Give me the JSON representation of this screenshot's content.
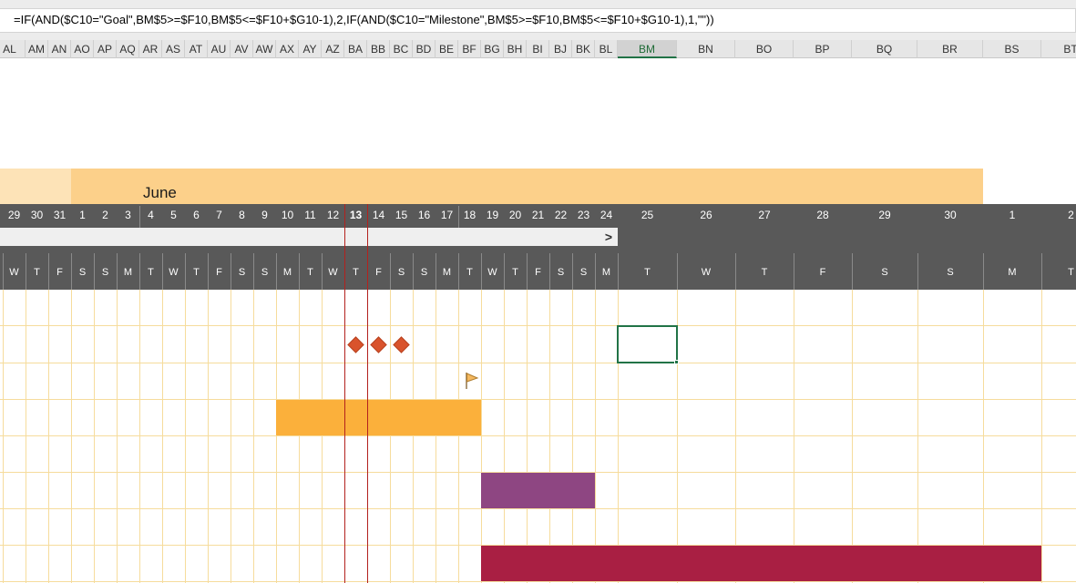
{
  "formula": "=IF(AND($C10=\"Goal\",BM$5>=$F10,BM$5<=$F10+$G10-1),2,IF(AND($C10=\"Milestone\",BM$5>=$F10,BM$5<=$F10+$G10-1),1,\"\"))",
  "columns": [
    "AL",
    "AM",
    "AN",
    "AO",
    "AP",
    "AQ",
    "AR",
    "AS",
    "AT",
    "AU",
    "AV",
    "AW",
    "AX",
    "AY",
    "AZ",
    "BA",
    "BB",
    "BC",
    "BD",
    "BE",
    "BF",
    "BG",
    "BH",
    "BI",
    "BJ",
    "BK",
    "BL",
    "BM",
    "BN",
    "BO",
    "BP",
    "BQ",
    "BR",
    "BS",
    "BT"
  ],
  "selected_column": "BM",
  "month": "June",
  "days": [
    "29",
    "30",
    "31",
    "1",
    "2",
    "3",
    "4",
    "5",
    "6",
    "7",
    "8",
    "9",
    "10",
    "11",
    "12",
    "13",
    "14",
    "15",
    "16",
    "17",
    "18",
    "19",
    "20",
    "21",
    "22",
    "23",
    "24",
    "25",
    "26",
    "27",
    "28",
    "29",
    "30",
    "1",
    "2"
  ],
  "weekdays": [
    "W",
    "T",
    "F",
    "S",
    "S",
    "M",
    "T",
    "W",
    "T",
    "F",
    "S",
    "S",
    "M",
    "T",
    "W",
    "T",
    "F",
    "S",
    "S",
    "M",
    "T",
    "W",
    "T",
    "F",
    "S",
    "S",
    "M",
    "T",
    "W",
    "T",
    "F",
    "S",
    "S",
    "M",
    "T"
  ],
  "today_index": 15,
  "scroll_arrow": ">",
  "colors": {
    "month_band": "#fcd08a",
    "header_dark": "#595959",
    "grid_line": "#f6dc9c",
    "today_line": "#b3211d",
    "milestone": "#d9532c",
    "bar_orange": "#fbb03b",
    "bar_purple": "#8e4682",
    "bar_crimson": "#a91f43",
    "selection": "#217346"
  },
  "icons": [
    "diamond-milestone-icon",
    "goal-flag-icon"
  ],
  "tasks": [
    {
      "type": "milestones",
      "day_indices": [
        15,
        16,
        17
      ],
      "color_key": "milestone"
    },
    {
      "type": "goal",
      "day_index": 20
    },
    {
      "type": "bar",
      "start_index": 12,
      "end_index": 21,
      "color_key": "bar_orange"
    },
    {
      "type": "bar",
      "start_index": 21,
      "end_index": 26,
      "color_key": "bar_purple"
    },
    {
      "type": "bar",
      "start_index": 21,
      "end_index": 34,
      "color_key": "bar_crimson"
    }
  ]
}
